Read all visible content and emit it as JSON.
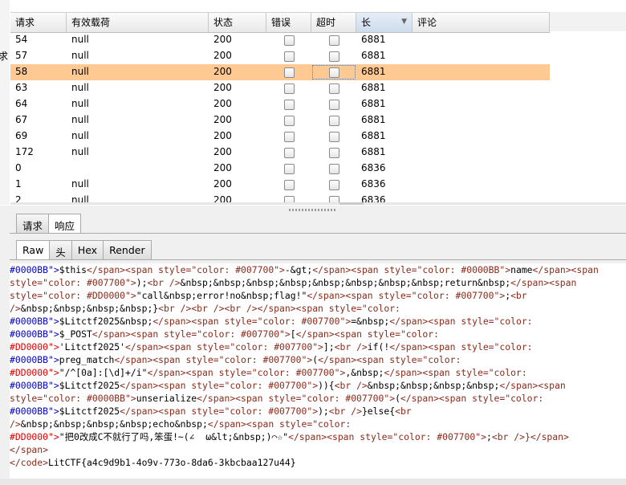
{
  "left_fragment": "求",
  "table": {
    "columns": [
      "请求",
      "有效载荷",
      "状态",
      "错误",
      "超时",
      "长",
      "评论"
    ],
    "sorted_column": "长",
    "rows": [
      {
        "request": "54",
        "payload": "null",
        "status": "200",
        "error": false,
        "timeout": false,
        "length": "6881",
        "comment": "",
        "selected": false
      },
      {
        "request": "57",
        "payload": "null",
        "status": "200",
        "error": false,
        "timeout": false,
        "length": "6881",
        "comment": "",
        "selected": false
      },
      {
        "request": "58",
        "payload": "null",
        "status": "200",
        "error": false,
        "timeout": false,
        "length": "6881",
        "comment": "",
        "selected": true
      },
      {
        "request": "63",
        "payload": "null",
        "status": "200",
        "error": false,
        "timeout": false,
        "length": "6881",
        "comment": "",
        "selected": false
      },
      {
        "request": "64",
        "payload": "null",
        "status": "200",
        "error": false,
        "timeout": false,
        "length": "6881",
        "comment": "",
        "selected": false
      },
      {
        "request": "67",
        "payload": "null",
        "status": "200",
        "error": false,
        "timeout": false,
        "length": "6881",
        "comment": "",
        "selected": false
      },
      {
        "request": "69",
        "payload": "null",
        "status": "200",
        "error": false,
        "timeout": false,
        "length": "6881",
        "comment": "",
        "selected": false
      },
      {
        "request": "172",
        "payload": "null",
        "status": "200",
        "error": false,
        "timeout": false,
        "length": "6881",
        "comment": "",
        "selected": false
      },
      {
        "request": "0",
        "payload": "",
        "status": "200",
        "error": false,
        "timeout": false,
        "length": "6836",
        "comment": "",
        "selected": false
      },
      {
        "request": "1",
        "payload": "null",
        "status": "200",
        "error": false,
        "timeout": false,
        "length": "6836",
        "comment": "",
        "selected": false
      },
      {
        "request": "2",
        "payload": "null",
        "status": "200",
        "error": false,
        "timeout": false,
        "length": "6836",
        "comment": "",
        "selected": false
      }
    ]
  },
  "message_tabs": [
    "请求",
    "响应"
  ],
  "message_active": "响应",
  "view_tabs": [
    "Raw",
    "头",
    "Hex",
    "Render"
  ],
  "view_active": "Raw",
  "code_lines": [
    [
      [
        "k",
        "#0000BB\">"
      ],
      [
        "txt",
        "$this"
      ],
      [
        "tag",
        "</span><span style=\"color: #007700\">"
      ],
      [
        "txt",
        "-&gt;"
      ],
      [
        "tag",
        "</span><span style=\"color: #0000BB\">"
      ],
      [
        "txt",
        "name"
      ],
      [
        "tag",
        "</span><span"
      ]
    ],
    [
      [
        "tag",
        "style=\"color: #007700\">"
      ],
      [
        "txt",
        ");"
      ],
      [
        "tag",
        "<br />"
      ],
      [
        "txt",
        "&nbsp;&nbsp;&nbsp;&nbsp;&nbsp;&nbsp;&nbsp;&nbsp;return&nbsp;"
      ],
      [
        "tag",
        "</span><span"
      ]
    ],
    [
      [
        "tag",
        "style=\"color: #DD0000\">"
      ],
      [
        "txt",
        "\"call&nbsp;error!no&nbsp;flag!\""
      ],
      [
        "tag",
        "</span><span style=\"color: #007700\">"
      ],
      [
        "txt",
        ";"
      ],
      [
        "tag",
        "<br"
      ]
    ],
    [
      [
        "tag",
        "/>"
      ],
      [
        "txt",
        "&nbsp;&nbsp;&nbsp;&nbsp;}"
      ],
      [
        "tag",
        "<br /><br /><br /></span><span style=\"color:"
      ]
    ],
    [
      [
        "k",
        "#0000BB\">"
      ],
      [
        "txt",
        "$Litctf2025&nbsp;"
      ],
      [
        "tag",
        "</span><span style=\"color: #007700\">"
      ],
      [
        "txt",
        "=&nbsp;"
      ],
      [
        "tag",
        "</span><span style=\"color:"
      ]
    ],
    [
      [
        "k",
        "#0000BB\">"
      ],
      [
        "txt",
        "$_POST"
      ],
      [
        "tag",
        "</span><span style=\"color: #007700\">"
      ],
      [
        "txt",
        "["
      ],
      [
        "tag",
        "</span><span style=\"color:"
      ]
    ],
    [
      [
        "red",
        "#DD0000\">"
      ],
      [
        "txt",
        "'Litctf2025'"
      ],
      [
        "tag",
        "</span><span style=\"color: #007700\">"
      ],
      [
        "txt",
        "];"
      ],
      [
        "tag",
        "<br />"
      ],
      [
        "txt",
        "if(!"
      ],
      [
        "tag",
        "</span><span style=\"color:"
      ]
    ],
    [
      [
        "k",
        "#0000BB\">"
      ],
      [
        "txt",
        "preg_match"
      ],
      [
        "tag",
        "</span><span style=\"color: #007700\">"
      ],
      [
        "txt",
        "("
      ],
      [
        "tag",
        "</span><span style=\"color:"
      ]
    ],
    [
      [
        "red",
        "#DD0000\">"
      ],
      [
        "txt",
        "\"/^[0a]:[\\d]+/i\""
      ],
      [
        "tag",
        "</span><span style=\"color: #007700\">"
      ],
      [
        "txt",
        ",&nbsp;"
      ],
      [
        "tag",
        "</span><span style=\"color:"
      ]
    ],
    [
      [
        "k",
        "#0000BB\">"
      ],
      [
        "txt",
        "$Litctf2025"
      ],
      [
        "tag",
        "</span><span style=\"color: #007700\">"
      ],
      [
        "txt",
        ")){"
      ],
      [
        "tag",
        "<br />"
      ],
      [
        "txt",
        "&nbsp;&nbsp;&nbsp;&nbsp;"
      ],
      [
        "tag",
        "</span><span"
      ]
    ],
    [
      [
        "tag",
        "style=\"color: #0000BB\">"
      ],
      [
        "txt",
        "unserialize"
      ],
      [
        "tag",
        "</span><span style=\"color: #007700\">"
      ],
      [
        "txt",
        "("
      ],
      [
        "tag",
        "</span><span style=\"color:"
      ]
    ],
    [
      [
        "k",
        "#0000BB\">"
      ],
      [
        "txt",
        "$Litctf2025"
      ],
      [
        "tag",
        "</span><span style=\"color: #007700\">"
      ],
      [
        "txt",
        ");"
      ],
      [
        "tag",
        "<br />"
      ],
      [
        "txt",
        "}else{"
      ],
      [
        "tag",
        "<br"
      ]
    ],
    [
      [
        "tag",
        "/>"
      ],
      [
        "txt",
        "&nbsp;&nbsp;&nbsp;&nbsp;echo&nbsp;"
      ],
      [
        "tag",
        "</span><span style=\"color:"
      ]
    ],
    [
      [
        "red",
        "#DD0000\">"
      ],
      [
        "txt",
        "\"把0改成C不就行了吗,笨蛋!~(∠  ω&lt;&nbsp;)⌒☆\""
      ],
      [
        "tag",
        "</span><span style=\"color: #007700\">"
      ],
      [
        "txt",
        ";"
      ],
      [
        "tag",
        "<br />}</span>"
      ]
    ],
    [
      [
        "tag",
        "</span>"
      ]
    ],
    [
      [
        "tag",
        "</code>"
      ],
      [
        "txt",
        "LitCTF{a4c9d9b1-4o9v-773o-8da6-3kbcbaa127u44}"
      ]
    ]
  ],
  "colors": {
    "selected_row": "#ffc994",
    "keyword": "#0000bb",
    "html_tag": "#8a2a1a",
    "string_literal": "#dd0000"
  }
}
